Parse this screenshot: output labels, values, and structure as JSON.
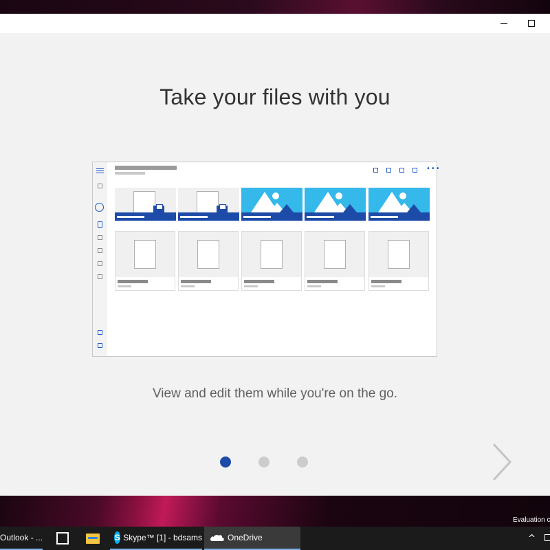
{
  "window": {
    "minimize_label": "minimize",
    "maximize_label": "maximize"
  },
  "onboarding": {
    "headline": "Take your files with you",
    "subline": "View and edit them while you're on the go.",
    "pages": 3,
    "active_page": 1
  },
  "desktop": {
    "evaluation_text": "Evaluation c"
  },
  "taskbar": {
    "items": [
      {
        "label": "Outlook - ...",
        "icon": "outlook-icon"
      },
      {
        "label": "",
        "icon": "calendar-icon"
      },
      {
        "label": "",
        "icon": "file-explorer-icon"
      },
      {
        "label": "Skype™ [1] - bdsams",
        "icon": "skype-icon"
      },
      {
        "label": "OneDrive",
        "icon": "onedrive-cloud-icon"
      }
    ],
    "tray_chevron": "^"
  },
  "colors": {
    "accent": "#1d4ba8",
    "tile_sky": "#35b8ea",
    "window_bg": "#f2f2f2"
  }
}
